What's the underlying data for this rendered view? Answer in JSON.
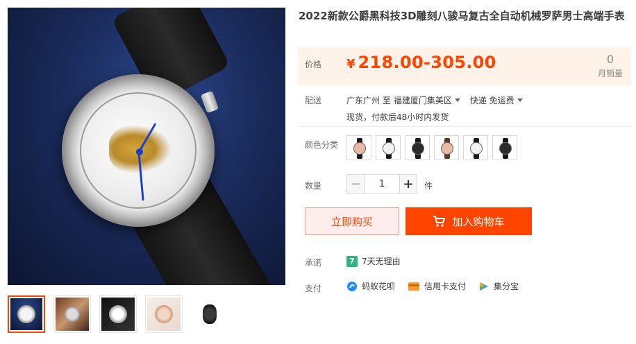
{
  "product": {
    "title": "2022新款公爵黑科技3D雕刻八骏马复古全自动机械罗萨男士高端手表"
  },
  "price": {
    "label": "价格",
    "currency": "¥",
    "range": "218.00-305.00",
    "sales_count": "0",
    "sales_label": "月销量"
  },
  "shipping": {
    "label": "配送",
    "from": "广东广州 至",
    "to": "福建厦门集美区",
    "method": "快递 免运费",
    "note": "现货，付款后48小时内发货"
  },
  "colors": {
    "label": "颜色分类",
    "swatch_faces": [
      "#e8b9a4",
      "#f2f2f2",
      "#2b2b2b",
      "#e8b9a4",
      "#f2f2f2",
      "#2b2b2b"
    ]
  },
  "quantity": {
    "label": "数量",
    "minus": "−",
    "value": "1",
    "plus": "+",
    "unit": "件"
  },
  "actions": {
    "buy_now": "立即购买",
    "add_to_cart": "加入购物车"
  },
  "promise": {
    "label": "承诺",
    "icon_text": "7",
    "text": "7天无理由"
  },
  "payment": {
    "label": "支付",
    "methods": [
      "蚂蚁花呗",
      "信用卡支付",
      "集分宝"
    ]
  },
  "theme": {
    "accent": "#ff4400",
    "price_bg": "#fff2e8"
  }
}
